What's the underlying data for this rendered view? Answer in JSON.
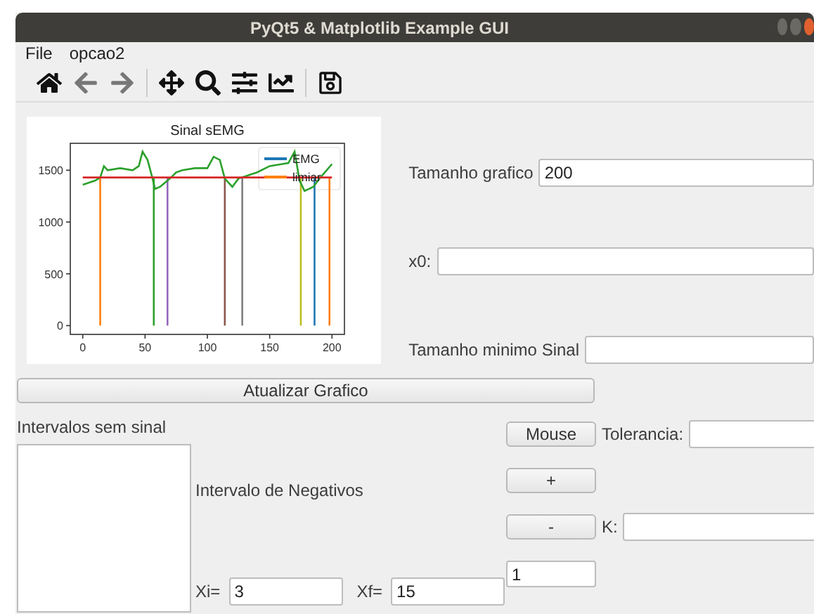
{
  "window": {
    "title": "PyQt5 & Matplotlib Example GUI"
  },
  "menu": [
    {
      "label": "File"
    },
    {
      "label": "opcao2"
    }
  ],
  "toolbar": [
    {
      "kind": "home",
      "disabled": false
    },
    {
      "kind": "back",
      "disabled": true
    },
    {
      "kind": "forward",
      "disabled": true
    },
    {
      "kind": "pan",
      "disabled": false
    },
    {
      "kind": "zoom",
      "disabled": false
    },
    {
      "kind": "subplots",
      "disabled": false
    },
    {
      "kind": "axes",
      "disabled": false
    },
    {
      "kind": "save",
      "disabled": false
    }
  ],
  "chart": {
    "chart_data": {
      "type": "line",
      "title": "Sinal sEMG",
      "x": [
        0,
        5,
        10,
        14,
        17,
        20,
        30,
        40,
        45,
        48,
        52,
        56,
        58,
        62,
        66,
        70,
        75,
        80,
        90,
        100,
        105,
        110,
        114,
        120,
        125,
        130,
        140,
        150,
        160,
        165,
        170,
        174,
        178,
        185,
        190,
        200
      ],
      "series": [
        {
          "name": "EMG",
          "color": "#2ca02c",
          "values": [
            1360,
            1380,
            1400,
            1430,
            1540,
            1500,
            1520,
            1500,
            1540,
            1680,
            1600,
            1420,
            1320,
            1340,
            1380,
            1420,
            1480,
            1500,
            1520,
            1520,
            1630,
            1600,
            1420,
            1340,
            1420,
            1440,
            1480,
            1540,
            1560,
            1570,
            1680,
            1400,
            1300,
            1340,
            1420,
            1560
          ]
        },
        {
          "name": "limiar",
          "color": "#d62728",
          "values": [
            1430,
            1430,
            1430,
            1430,
            1430,
            1430,
            1430,
            1430,
            1430,
            1430,
            1430,
            1430,
            1430,
            1430,
            1430,
            1430,
            1430,
            1430,
            1430,
            1430,
            1430,
            1430,
            1430,
            1430,
            1430,
            1430,
            1430,
            1430,
            1430,
            1430,
            1430,
            1430,
            1430,
            1430,
            1430,
            1430
          ]
        }
      ],
      "xlim": [
        -10,
        210
      ],
      "ylim": [
        -85,
        1760
      ],
      "xticks": [
        0,
        50,
        100,
        150,
        200
      ],
      "yticks": [
        0,
        500,
        1000,
        1500
      ],
      "ref_lines": [
        {
          "axis": "x",
          "value": 14,
          "color": "#ff7f0e"
        },
        {
          "axis": "x",
          "value": 57,
          "color": "#2ca02c"
        },
        {
          "axis": "x",
          "value": 68,
          "color": "#9467bd"
        },
        {
          "axis": "x",
          "value": 114,
          "color": "#8c564b"
        },
        {
          "axis": "x",
          "value": 128,
          "color": "#7f7f7f"
        },
        {
          "axis": "x",
          "value": 175,
          "color": "#bcbd22"
        },
        {
          "axis": "x",
          "value": 186,
          "color": "#1f77b4"
        },
        {
          "axis": "x",
          "value": 198,
          "color": "#ff7f0e"
        }
      ]
    },
    "legend": [
      {
        "color": "#1f77b4"
      },
      {
        "color": "#ff7f0e"
      }
    ]
  },
  "right_fields": [
    {
      "label": "Tamanho grafico",
      "value": "200"
    },
    {
      "label": "x0:"
    },
    {
      "label": "Tamanho minimo Sinal"
    }
  ],
  "update_button": {
    "label": "Atualizar Grafico"
  },
  "intervals": {
    "label": "Intervalos sem sinal"
  },
  "negatives": {
    "label": "Intervalo de Negativos",
    "xi": {
      "label": "Xi=",
      "value": "3"
    },
    "xf": {
      "label": "Xf=",
      "value": "15"
    }
  },
  "buttons": [
    {
      "label": "Mouse",
      "field": {
        "label": "Tolerancia:"
      }
    },
    {
      "label": "+"
    },
    {
      "label": "-",
      "field": {
        "label": "K:"
      }
    }
  ],
  "step_field": {
    "value": "1"
  }
}
